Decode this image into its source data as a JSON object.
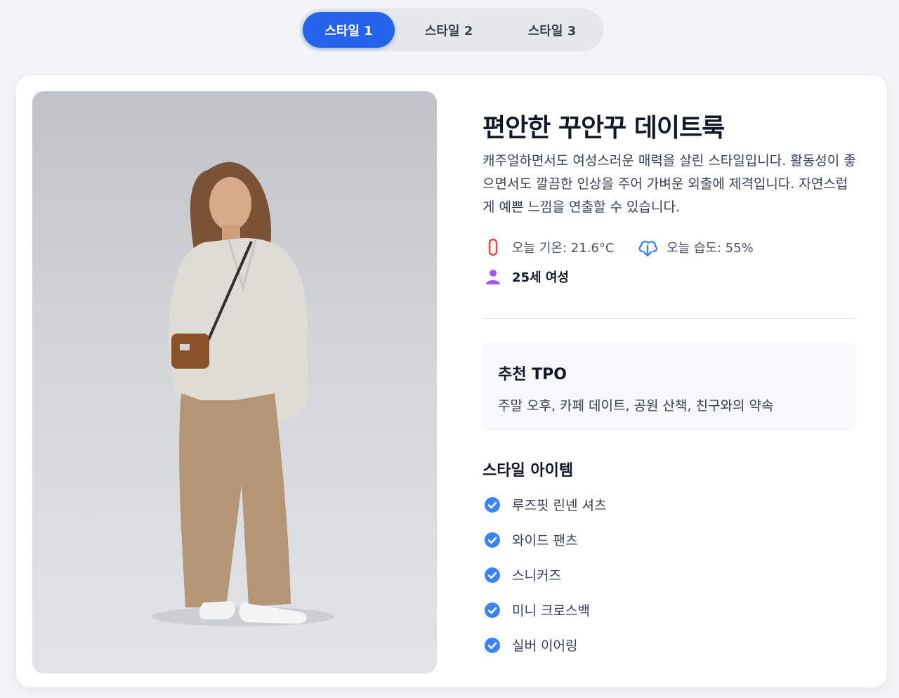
{
  "tabs": [
    {
      "label": "스타일 1",
      "active": true
    },
    {
      "label": "스타일 2",
      "active": false
    },
    {
      "label": "스타일 3",
      "active": false
    }
  ],
  "style": {
    "title": "편안한 꾸안꾸 데이트룩",
    "description": "캐주얼하면서도 여성스러운 매력을 살린 스타일입니다. 활동성이 좋으면서도 깔끔한 인상을 주어 가벼운 외출에 제격입니다. 자연스럽게 예쁜 느낌을 연출할 수 있습니다.",
    "temperature": "오늘 기온: 21.6°C",
    "humidity": "오늘 습도: 55%",
    "persona": "25세 여성"
  },
  "tpo": {
    "title": "추천 TPO",
    "text": "주말 오후, 카페 데이트, 공원 산책, 친구와의 약속"
  },
  "items": {
    "title": "스타일 아이템",
    "list": [
      "루즈핏 린넨 셔츠",
      "와이드 팬츠",
      "스니커즈",
      "미니 크로스백",
      "실버 이어링"
    ]
  },
  "colors": {
    "accent": "#2563eb",
    "check": "#3b82f6",
    "temp_icon": "#ef4444",
    "humidity_icon": "#3b82f6",
    "person_icon": "#a855f7"
  },
  "icons": {
    "temperature": "thermometer-icon",
    "humidity": "cloud-download-icon",
    "persona": "person-icon",
    "item": "check-circle-icon"
  }
}
